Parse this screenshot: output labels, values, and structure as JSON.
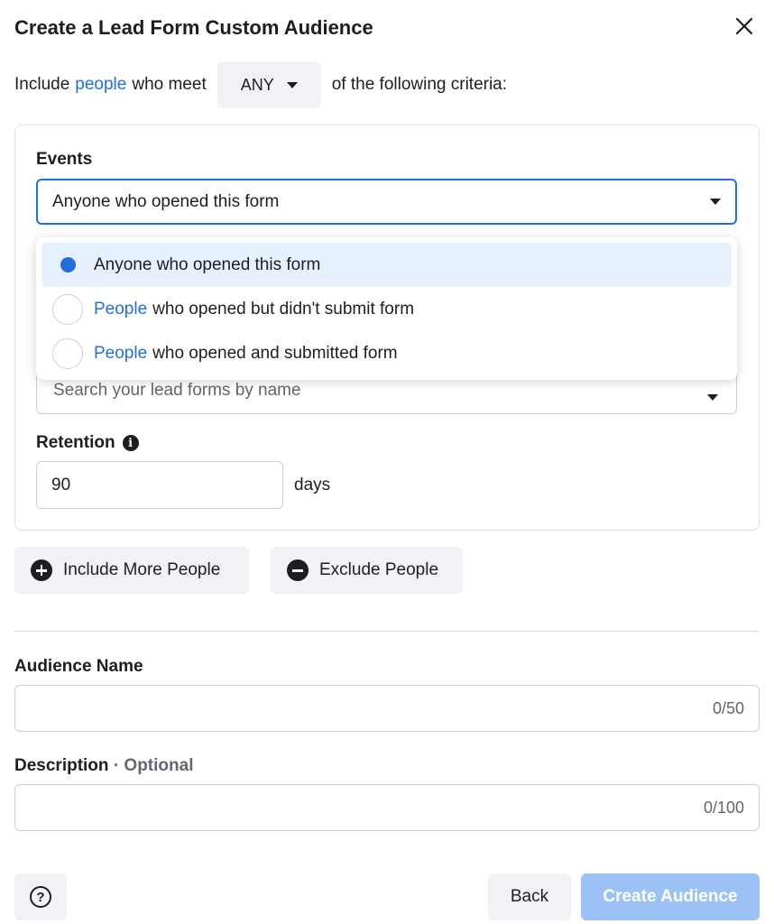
{
  "dialog": {
    "title": "Create a Lead Form Custom Audience"
  },
  "criteria": {
    "prefix": "Include",
    "people_link": "people",
    "middle": "who meet",
    "match_value": "ANY",
    "suffix": "of the following criteria:"
  },
  "events": {
    "label": "Events",
    "selected": "Anyone who opened this form",
    "options": [
      {
        "highlight": "",
        "text": "Anyone who opened this form",
        "selected": true
      },
      {
        "highlight": "People",
        "text": "who opened but didn't submit form",
        "selected": false
      },
      {
        "highlight": "People",
        "text": "who opened and submitted form",
        "selected": false
      }
    ]
  },
  "forms": {
    "placeholder": "Search your lead forms by name"
  },
  "retention": {
    "label": "Retention",
    "value": "90",
    "unit": "days"
  },
  "actions": {
    "include_label": "Include More People",
    "exclude_label": "Exclude People"
  },
  "audience_name": {
    "label": "Audience Name",
    "counter": "0/50"
  },
  "description": {
    "label": "Description",
    "optional": "· Optional",
    "counter": "0/100"
  },
  "footer": {
    "back_label": "Back",
    "create_label": "Create Audience"
  },
  "colors": {
    "accent": "#216fdb",
    "disabled_primary": "#9cc2f5",
    "secondary_bg": "#f0f2f5",
    "selected_option_bg": "#e7f0fd"
  }
}
